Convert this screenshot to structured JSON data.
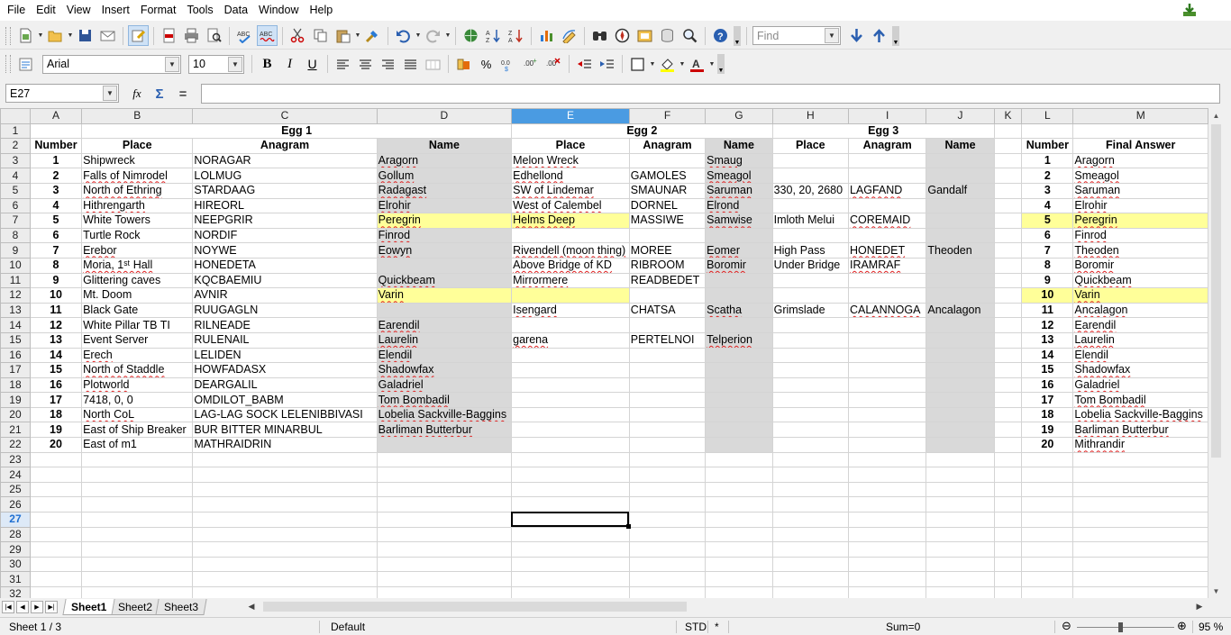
{
  "menu": [
    "File",
    "Edit",
    "View",
    "Insert",
    "Format",
    "Tools",
    "Data",
    "Window",
    "Help"
  ],
  "toolbar": {
    "find_placeholder": "Find",
    "font_name": "Arial",
    "font_size": "10"
  },
  "formula_bar": {
    "cell_ref": "E27",
    "fx_label": "fx",
    "sum_label": "Σ",
    "equals_label": "=",
    "content": ""
  },
  "sheet": {
    "columns": [
      "A",
      "B",
      "C",
      "D",
      "E",
      "F",
      "G",
      "H",
      "I",
      "J",
      "K",
      "L",
      "M"
    ],
    "selected_column": "E",
    "selected_row": 27,
    "header_row": {
      "egg1": "Egg 1",
      "egg2": "Egg 2",
      "egg3": "Egg 3"
    },
    "subheaders": [
      "Number",
      "Place",
      "Anagram",
      "Name",
      "Place",
      "Anagram",
      "Name",
      "Place",
      "Anagram",
      "Name",
      "",
      "Number",
      "Final Answer"
    ],
    "rows": [
      [
        "1",
        "Shipwreck",
        "NORAGAR",
        "Aragorn",
        "Melon Wreck",
        "",
        "Smaug",
        "",
        "",
        "",
        "",
        "1",
        "Aragorn"
      ],
      [
        "2",
        "Falls of Nimrodel",
        "LOLMUG",
        "Gollum",
        "Edhellond",
        "GAMOLES",
        "Smeagol",
        "",
        "",
        "",
        "",
        "2",
        "Smeagol"
      ],
      [
        "3",
        "North of Ethring",
        "STARDAAG",
        "Radagast",
        "SW of Lindemar",
        "SMAUNAR",
        "Saruman",
        "330, 20, 2680",
        "LAGFAND",
        "Gandalf",
        "",
        "3",
        "Saruman"
      ],
      [
        "4",
        "Hithrengarth",
        "HIREORL",
        "Elrohir",
        "West of Calembel",
        "DORNEL",
        "Elrond",
        "",
        "",
        "",
        "",
        "4",
        "Elrohir"
      ],
      [
        "5",
        "White Towers",
        "NEEPGRIR",
        "Peregrin",
        "Helms Deep",
        "MASSIWE",
        "Samwise",
        "Imloth Melui",
        "COREMAID",
        "",
        "",
        "5",
        "Peregrin"
      ],
      [
        "6",
        "Turtle Rock",
        "NORDIF",
        "Finrod",
        "",
        "",
        "",
        "",
        "",
        "",
        "",
        "6",
        "Finrod"
      ],
      [
        "7",
        "Erebor",
        "NOYWE",
        "Eowyn",
        "Rivendell (moon thing)",
        "MOREE",
        "Eomer",
        "High Pass",
        "HONEDET",
        "Theoden",
        "",
        "7",
        "Theoden"
      ],
      [
        "8",
        "Moria, 1ˢᵗ Hall",
        "HONEDETA",
        "",
        "Above Bridge of KD",
        "RIBROOM",
        "Boromir",
        "Under Bridge",
        "IRAMRAF",
        "",
        "",
        "8",
        "Boromir"
      ],
      [
        "9",
        "Glittering caves",
        "KQCBAEMIU",
        "Quickbeam",
        "Mirrormere",
        "READBEDET",
        "",
        "",
        "",
        "",
        "",
        "9",
        "Quickbeam"
      ],
      [
        "10",
        "Mt. Doom",
        "AVNIR",
        "Varin",
        "",
        "",
        "",
        "",
        "",
        "",
        "",
        "10",
        "Varin"
      ],
      [
        "11",
        "Black Gate",
        "RUUGAGLN",
        "",
        "Isengard",
        "CHATSA",
        "Scatha",
        "Grimslade",
        "CALANNOGA",
        "Ancalagon",
        "",
        "11",
        "Ancalagon"
      ],
      [
        "12",
        "White Pillar TB TI",
        "RILNEADE",
        "Earendil",
        "",
        "",
        "",
        "",
        "",
        "",
        "",
        "12",
        "Earendil"
      ],
      [
        "13",
        "Event Server",
        "RULENAIL",
        "Laurelin",
        "garena",
        "PERTELNOI",
        "Telperion",
        "",
        "",
        "",
        "",
        "13",
        "Laurelin"
      ],
      [
        "14",
        "Erech",
        "LELIDEN",
        "Elendil",
        "",
        "",
        "",
        "",
        "",
        "",
        "",
        "14",
        "Elendil"
      ],
      [
        "15",
        "North of Staddle",
        "HOWFADASX",
        "Shadowfax",
        "",
        "",
        "",
        "",
        "",
        "",
        "",
        "15",
        "Shadowfax"
      ],
      [
        "16",
        "Plotworld",
        "DEARGALIL",
        "Galadriel",
        "",
        "",
        "",
        "",
        "",
        "",
        "",
        "16",
        "Galadriel"
      ],
      [
        "17",
        "7418, 0, 0",
        "OMDILOT_BABM",
        "Tom Bombadil",
        "",
        "",
        "",
        "",
        "",
        "",
        "",
        "17",
        "Tom Bombadil"
      ],
      [
        "18",
        "North CoL",
        "LAG-LAG SOCK LELENIBBIVASI",
        "Lobelia Sackville-Baggins",
        "",
        "",
        "",
        "",
        "",
        "",
        "",
        "18",
        "Lobelia Sackville-Baggins"
      ],
      [
        "19",
        "East of Ship Breaker",
        "BUR BITTER MINARBUL",
        "Barliman Butterbur",
        "",
        "",
        "",
        "",
        "",
        "",
        "",
        "19",
        "Barliman Butterbur"
      ],
      [
        "20",
        "East of m1",
        "MATHRAIDRIN",
        "",
        "",
        "",
        "",
        "",
        "",
        "",
        "",
        "20",
        "Mithrandir"
      ]
    ],
    "highlight_rows": [
      5,
      10
    ]
  },
  "tabs": [
    "Sheet1",
    "Sheet2",
    "Sheet3"
  ],
  "active_tab": "Sheet1",
  "status": {
    "sheet": "Sheet 1 / 3",
    "style": "Default",
    "mode": "STD",
    "modified": "*",
    "sum": "Sum=0",
    "zoom": "95 %"
  }
}
